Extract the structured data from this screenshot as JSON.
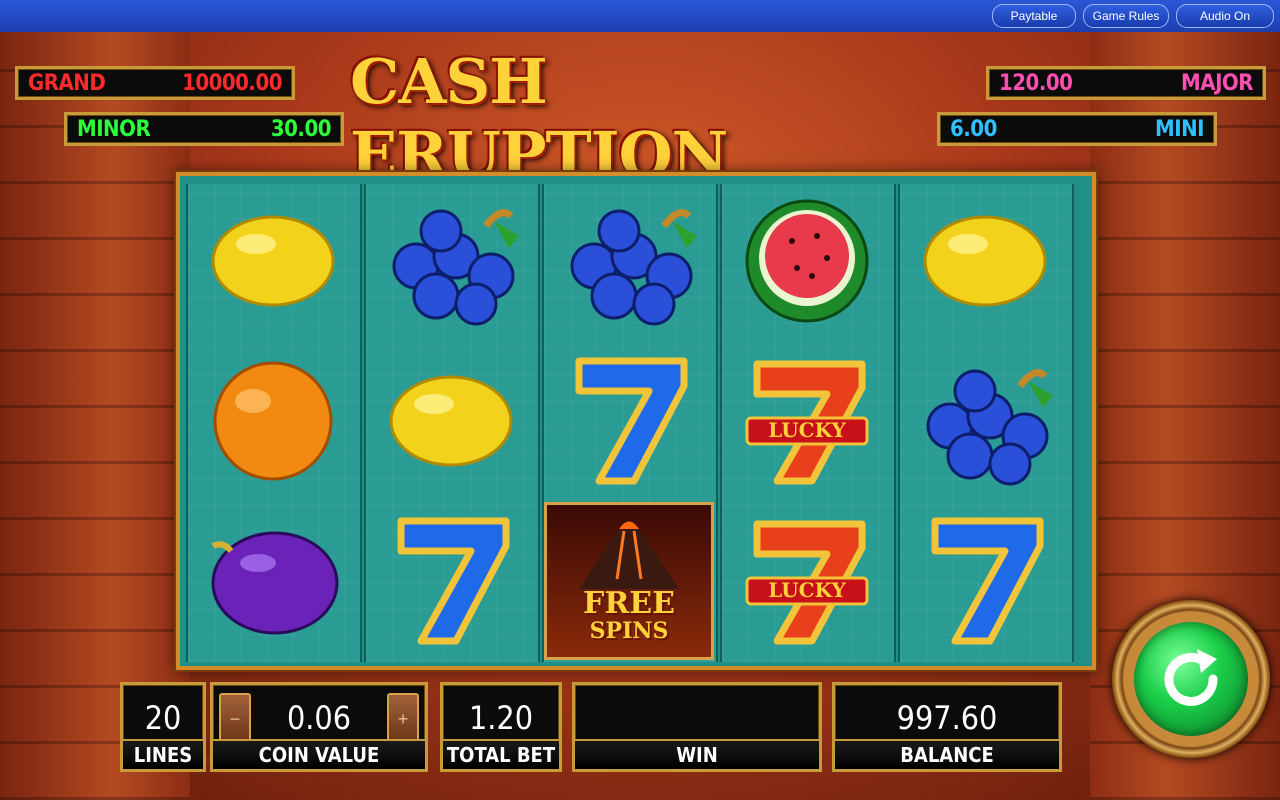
{
  "topbar": {
    "paytable": "Paytable",
    "game_rules": "Game Rules",
    "audio": "Audio On"
  },
  "title": "CASH ERUPTION",
  "jackpots": {
    "grand": {
      "label": "GRAND",
      "value": "10000.00"
    },
    "minor": {
      "label": "MINOR",
      "value": "30.00"
    },
    "major": {
      "label": "MAJOR",
      "value": "120.00"
    },
    "mini": {
      "label": "MINI",
      "value": "6.00"
    }
  },
  "reels": [
    [
      "lemon",
      "orange",
      "plum"
    ],
    [
      "grapes",
      "lemon",
      "blue-seven"
    ],
    [
      "grapes",
      "blue-seven",
      "free-spins"
    ],
    [
      "watermelon",
      "lucky-seven",
      "lucky-seven"
    ],
    [
      "lemon",
      "grapes",
      "blue-seven"
    ]
  ],
  "symbol_text": {
    "lucky": "LUCKY",
    "free": "FREE",
    "spins": "SPINS"
  },
  "panel": {
    "lines": {
      "value": "20",
      "label": "LINES"
    },
    "coin_value": {
      "value": "0.06",
      "label": "COIN VALUE",
      "minus": "−",
      "plus": "+"
    },
    "total_bet": {
      "value": "1.20",
      "label": "TOTAL BET"
    },
    "win": {
      "value": "",
      "label": "WIN"
    },
    "balance": {
      "value": "997.60",
      "label": "BALANCE"
    }
  },
  "colors": {
    "grand": "#ff2a2a",
    "minor": "#2bff3a",
    "major": "#ff4fb3",
    "mini": "#2fc0ff",
    "gold": "#c89a3a",
    "reel_bg": "#2a9c94"
  },
  "icons": {
    "spin": "spin-arrow-icon"
  }
}
